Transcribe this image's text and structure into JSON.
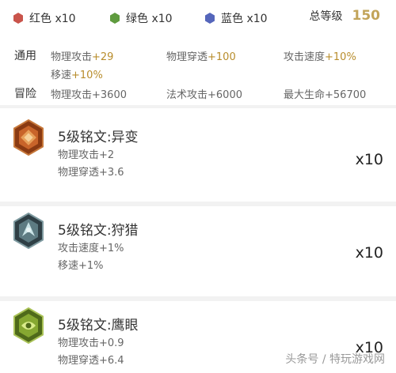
{
  "summary": {
    "red": {
      "label": "红色 x10",
      "color": "#c9544b",
      "icon": "red-gem-icon"
    },
    "green": {
      "label": "绿色 x10",
      "color": "#5f9b3f",
      "icon": "green-gem-icon"
    },
    "blue": {
      "label": "蓝色 x10",
      "color": "#5566bb",
      "icon": "blue-gem-icon"
    },
    "total_label": "总等级",
    "total_value": "150"
  },
  "general": {
    "category": "通用",
    "stats": [
      {
        "name": "物理攻击",
        "value": "+29"
      },
      {
        "name": "物理穿透",
        "value": "+100"
      },
      {
        "name": "攻击速度",
        "value": "+10%"
      },
      {
        "name": "移速",
        "value": "+10%"
      }
    ]
  },
  "adventure": {
    "category": "冒险",
    "stats": [
      {
        "name": "物理攻击",
        "value": "+3600"
      },
      {
        "name": "法术攻击",
        "value": "+6000"
      },
      {
        "name": "最大生命",
        "value": "+56700"
      }
    ]
  },
  "runes": [
    {
      "title": "5级铭文:异变",
      "color": "red",
      "icon": "red-rune-icon",
      "stats": [
        {
          "name": "物理攻击",
          "value": "+2"
        },
        {
          "name": "物理穿透",
          "value": "+3.6"
        }
      ],
      "count": "x10"
    },
    {
      "title": "5级铭文:狩猎",
      "color": "blue",
      "icon": "blue-rune-icon",
      "stats": [
        {
          "name": "攻击速度",
          "value": "+1%"
        },
        {
          "name": "移速",
          "value": "+1%"
        }
      ],
      "count": "x10"
    },
    {
      "title": "5级铭文:鹰眼",
      "color": "green",
      "icon": "green-rune-icon",
      "stats": [
        {
          "name": "物理攻击",
          "value": "+0.9"
        },
        {
          "name": "物理穿透",
          "value": "+6.4"
        }
      ],
      "count": "x10"
    }
  ],
  "watermark": "头条号 / 特玩游戏网"
}
